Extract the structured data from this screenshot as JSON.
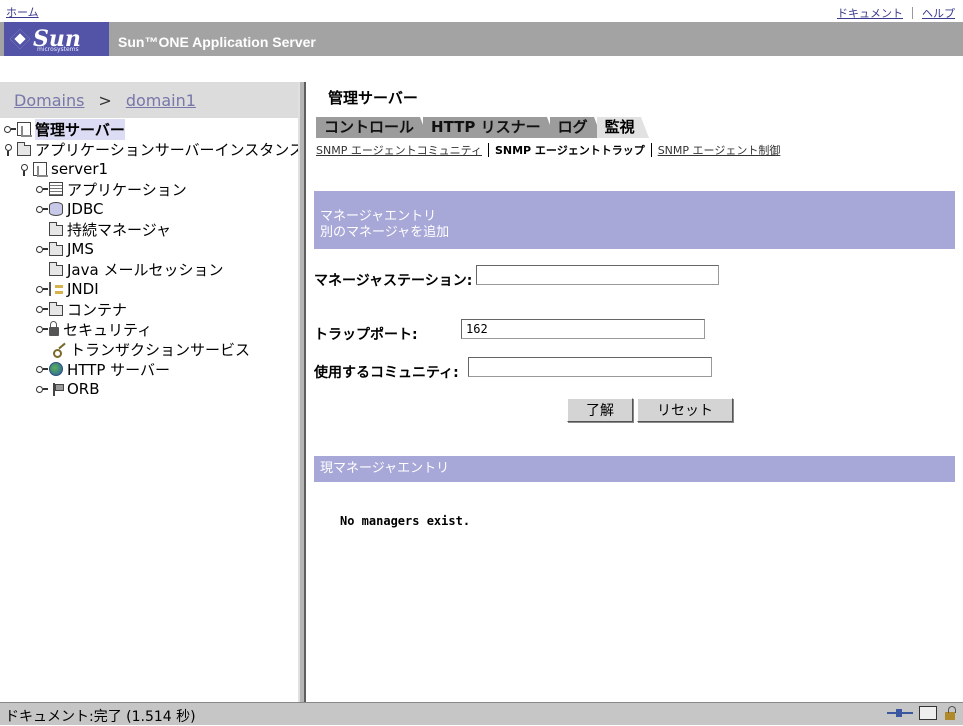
{
  "header": {
    "home_link": "ホーム",
    "doc_link": "ドキュメント",
    "help_link": "ヘルプ",
    "brand": "Sun",
    "brand_sub": "microsystems",
    "product": "Sun™ONE Application Server"
  },
  "breadcrumb": {
    "root": "Domains",
    "separator": ">",
    "domain": "domain1"
  },
  "tree": {
    "items": [
      {
        "label": "管理サーバー",
        "icon": "server-icon"
      },
      {
        "label": "アプリケーションサーバーインスタンス",
        "icon": "folder-icon"
      },
      {
        "label": "server1",
        "icon": "server-icon"
      },
      {
        "label": "アプリケーション",
        "icon": "list-icon"
      },
      {
        "label": "JDBC",
        "icon": "database-icon"
      },
      {
        "label": "持続マネージャ",
        "icon": "folder-icon"
      },
      {
        "label": "JMS",
        "icon": "folder-icon"
      },
      {
        "label": "Java メールセッション",
        "icon": "folder-icon"
      },
      {
        "label": "JNDI",
        "icon": "tree-icon"
      },
      {
        "label": "コンテナ",
        "icon": "folder-icon"
      },
      {
        "label": "セキュリティ",
        "icon": "lock-icon"
      },
      {
        "label": "トランザクションサービス",
        "icon": "key-icon"
      },
      {
        "label": "HTTP サーバー",
        "icon": "globe-icon"
      },
      {
        "label": "ORB",
        "icon": "orb-icon"
      }
    ]
  },
  "main": {
    "heading": "管理サーバー",
    "tabs": [
      "コントロール",
      "HTTP リスナー",
      "ログ",
      "監視"
    ],
    "subtabs": [
      "SNMP エージェントコミュニティ",
      "SNMP エージェントトラップ",
      "SNMP エージェント制御"
    ],
    "section_new": {
      "line1": "マネージャエントリ",
      "line2": "別のマネージャを追加"
    },
    "form": {
      "station_label": "マネージャステーション:",
      "station_value": "",
      "port_label": "トラップポート:",
      "port_value": "162",
      "community_label": "使用するコミュニティ:",
      "community_value": ""
    },
    "ok_button": "了解",
    "reset_button": "リセット",
    "section_current": "現マネージャエントリ",
    "no_managers": "No managers exist."
  },
  "status": {
    "text": "ドキュメント:完了 (1.514 秒)"
  },
  "colors": {
    "section": "#a8a8d8",
    "logo": "#5353a8",
    "banner": "#a3a3a3"
  }
}
